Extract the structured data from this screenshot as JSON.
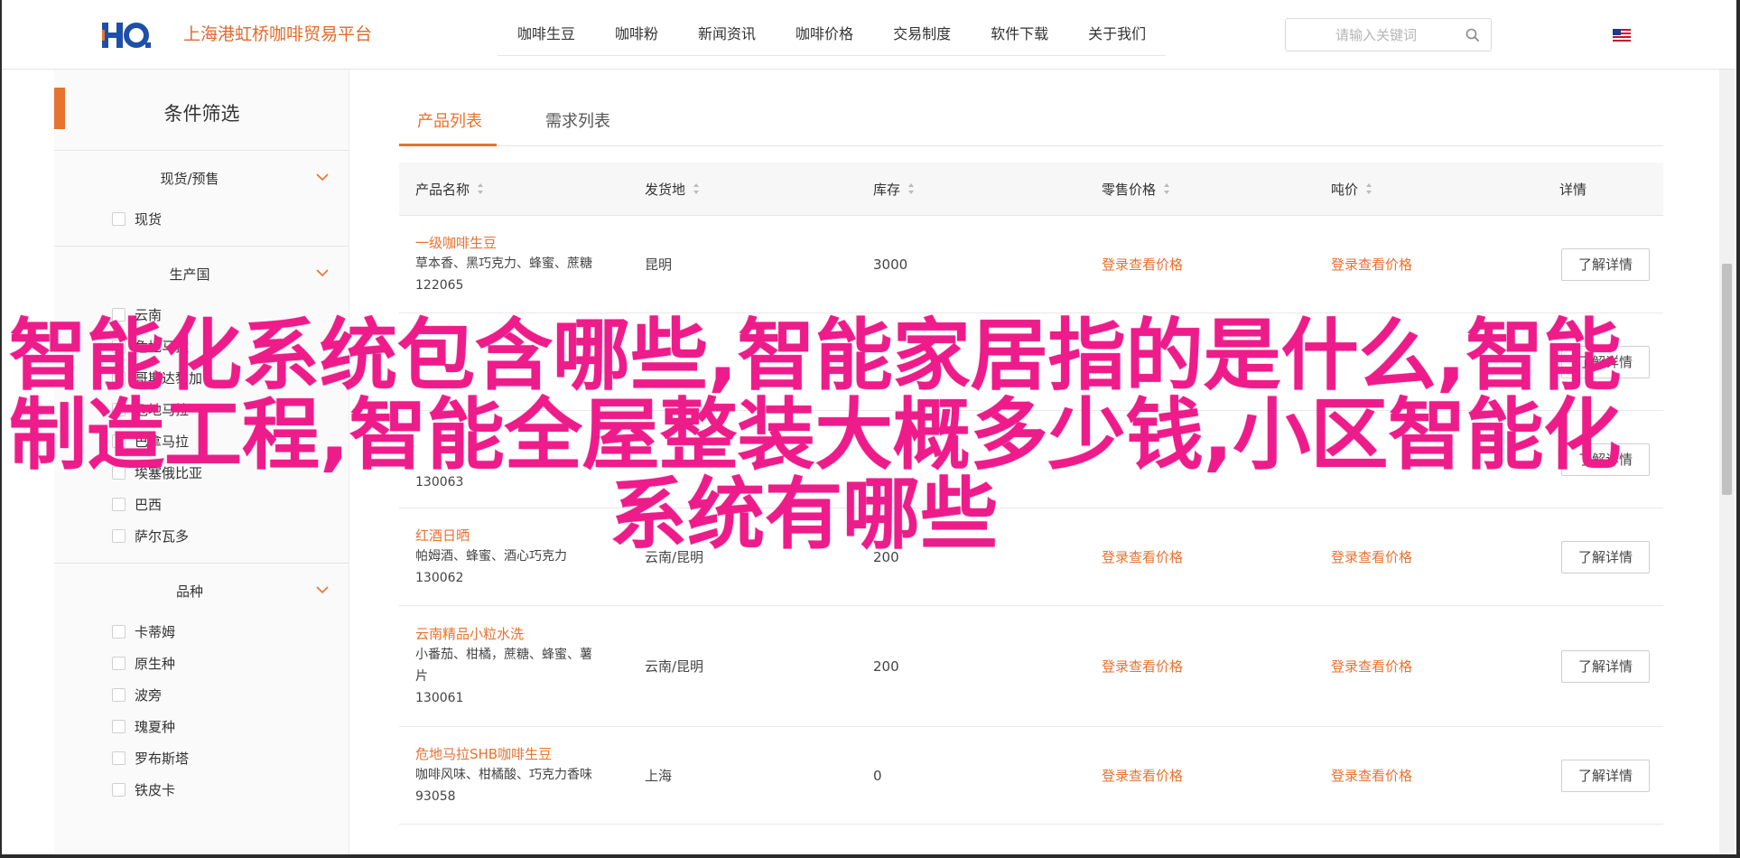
{
  "header": {
    "logo_text": "HQ",
    "brand": "上海港虹桥咖啡贸易平台",
    "nav": [
      "咖啡生豆",
      "咖啡粉",
      "新闻资讯",
      "咖啡价格",
      "交易制度",
      "软件下载",
      "关于我们"
    ],
    "search_placeholder": "请输入关键词"
  },
  "sidebar": {
    "title": "条件筛选",
    "groups": [
      {
        "title": "现货/预售",
        "options": [
          "现货"
        ]
      },
      {
        "title": "生产国",
        "options": [
          "云南",
          "危地马拉",
          "埃塞俄比亚",
          "巴西",
          "萨尔瓦多"
        ],
        "hidden_partial": [
          "云南",
          "危地马拉",
          "哥斯达黎加",
          "危地马拉",
          "巴拿马拉"
        ]
      },
      {
        "title": "品种",
        "options": [
          "卡蒂姆",
          "原生种",
          "波旁",
          "瑰夏种",
          "罗布斯塔",
          "铁皮卡"
        ]
      }
    ]
  },
  "tabs": [
    "产品列表",
    "需求列表"
  ],
  "table": {
    "headers": [
      "产品名称",
      "发货地",
      "库存",
      "零售价格",
      "吨价",
      "详情"
    ],
    "rows": [
      {
        "name": "一级咖啡生豆",
        "desc": [
          "草本香、黑巧克力、蜂蜜、蔗糖"
        ],
        "id": "122065",
        "origin": "昆明",
        "stock": "3000",
        "retail": "登录查看价格",
        "ton": "登录查看价格",
        "btn": "了解详情"
      },
      {
        "name": "",
        "desc": [
          ""
        ],
        "id": "",
        "origin": "",
        "stock": "",
        "retail": "",
        "ton": "",
        "btn": "了解详情"
      },
      {
        "name": "",
        "desc": [
          ""
        ],
        "id": "130063",
        "origin": "",
        "stock": "",
        "retail": "",
        "ton": "",
        "btn": "了解详情"
      },
      {
        "name": "红酒日晒",
        "desc": [
          "帕姆酒、蜂蜜、酒心巧克力"
        ],
        "id": "130062",
        "origin": "云南/昆明",
        "stock": "200",
        "retail": "登录查看价格",
        "ton": "登录查看价格",
        "btn": "了解详情"
      },
      {
        "name": "云南精品小粒水洗",
        "desc": [
          "小番茄、柑橘，蔗糖、蜂蜜、薯",
          "片"
        ],
        "id": "130061",
        "origin": "云南/昆明",
        "stock": "200",
        "retail": "登录查看价格",
        "ton": "登录查看价格",
        "btn": "了解详情"
      },
      {
        "name": "危地马拉SHB咖啡生豆",
        "desc": [
          "咖啡风味、柑橘酸、巧克力香味"
        ],
        "id": "93058",
        "origin": "上海",
        "stock": "0",
        "retail": "登录查看价格",
        "ton": "登录查看价格",
        "btn": "了解详情"
      }
    ]
  },
  "overlay": {
    "line1": "智能化系统包含哪些,智能家居指的是什么,智能",
    "line2": "制造工程,智能全屋整装大概多少钱,小区智能化",
    "line3": "系统有哪些"
  },
  "colors": {
    "accent": "#e8722f",
    "overlay": "#ee1c8a",
    "logo": "#1e4fa8"
  }
}
